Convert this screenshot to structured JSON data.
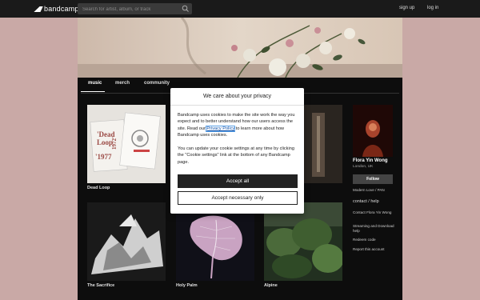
{
  "topbar": {
    "logo_text": "bandcamp",
    "search_placeholder": "Search for artist, album, or track",
    "signup": "sign up",
    "login": "log in"
  },
  "tabs": [
    {
      "label": "music"
    },
    {
      "label": "merch"
    },
    {
      "label": "community"
    }
  ],
  "albums": [
    {
      "title": "Dead Loop"
    },
    {
      "title": "The Sacrifice"
    },
    {
      "title": "Holy Palm"
    },
    {
      "title": "Alpine"
    }
  ],
  "dead_loop_cover": {
    "line1": "'Dead",
    "line2": "Loop",
    "line3": "'1977",
    "line4": "1972'"
  },
  "artist": {
    "name": "Flora Yin Wong",
    "location": "London, UK",
    "follow": "Follow",
    "label_link": "Modern Love / PAN",
    "contact_heading": "contact / help",
    "links": [
      "Contact Flora Yin Wong",
      "Streaming and Download help",
      "Redeem code",
      "Report this account"
    ]
  },
  "modal": {
    "title": "We care about your privacy",
    "p1_before": "Bandcamp uses cookies to make the site work the way you expect and to better understand how our users access the site. Read our ",
    "privacy_link": "Privacy Policy",
    "p1_after": " to learn more about how Bandcamp uses cookies.",
    "p2": "You can update your cookie settings at any time by clicking the \"Cookie settings\" link at the bottom of any Bandcamp page.",
    "accept_all": "Accept all",
    "accept_necessary": "Accept necessary only"
  }
}
